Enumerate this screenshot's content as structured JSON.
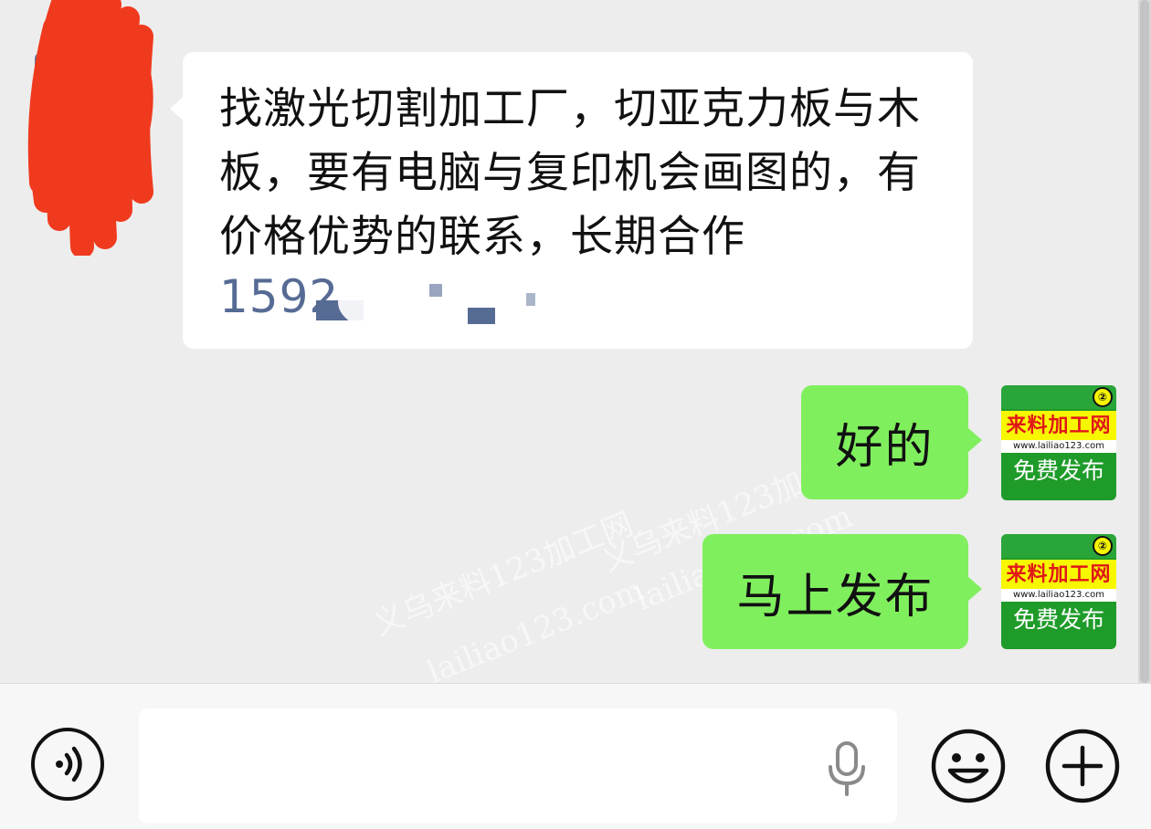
{
  "chat": {
    "incoming": {
      "text": "找激光切割加工厂，切亚克力板与木板，要有电脑与复印机会画图的，有价格优势的联系，长期合作",
      "phone_visible": "1592"
    },
    "outgoing": [
      {
        "text": "好的"
      },
      {
        "text": "马上发布"
      }
    ],
    "own_avatar": {
      "title": "来料加工网",
      "url": "www.lailiao123.com",
      "subtitle": "免费发布",
      "badge": "②"
    }
  },
  "watermark": {
    "line1": "义乌来料123加工网",
    "line2": "lailiao123.com"
  },
  "input_bar": {
    "voice_icon": "voice-icon",
    "mic_icon": "microphone-icon",
    "emoji_icon": "emoji-icon",
    "plus_icon": "plus-icon"
  },
  "colors": {
    "background": "#ededed",
    "incoming_bubble": "#ffffff",
    "outgoing_bubble": "#80ef5e",
    "phone_link": "#566b94",
    "scribble": "#f03a1e"
  }
}
